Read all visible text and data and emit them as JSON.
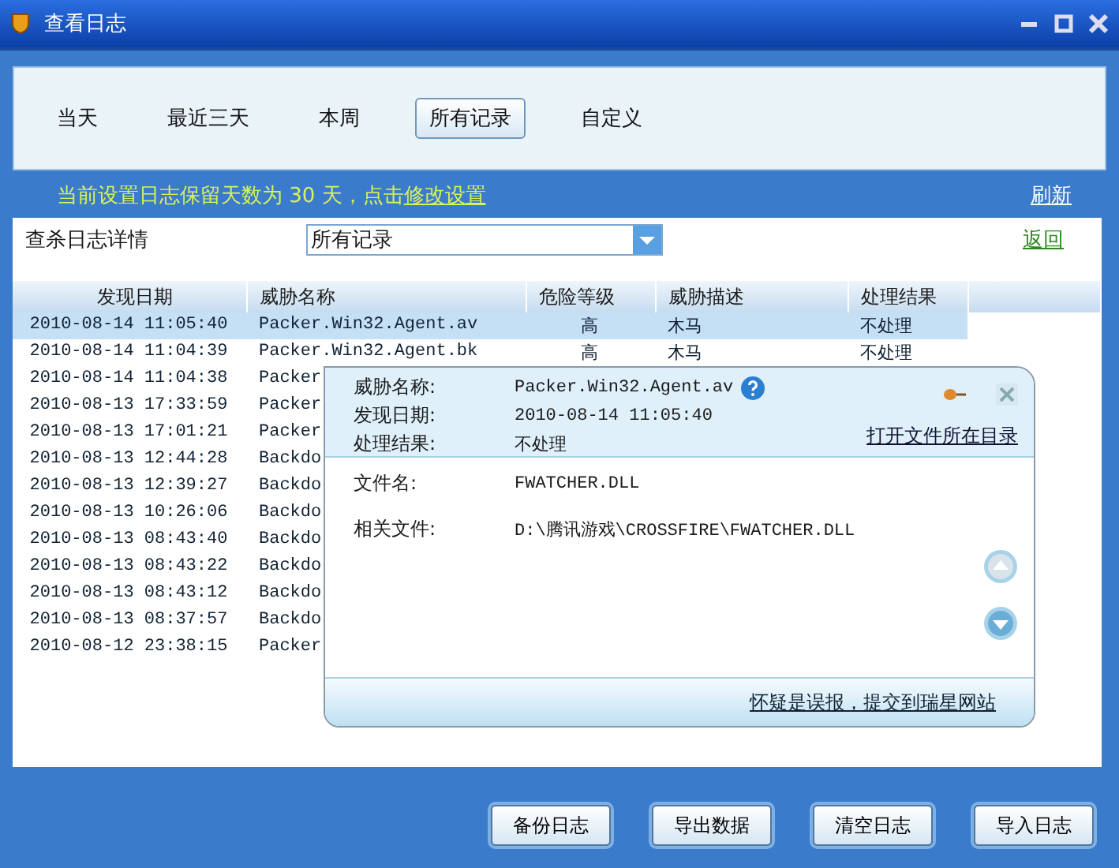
{
  "window": {
    "title": "查看日志"
  },
  "tabs": [
    {
      "label": "当天",
      "selected": false
    },
    {
      "label": "最近三天",
      "selected": false
    },
    {
      "label": "本周",
      "selected": false
    },
    {
      "label": "所有记录",
      "selected": true
    },
    {
      "label": "自定义",
      "selected": false
    }
  ],
  "retention_notice": {
    "text": "当前设置日志保留天数为 30 天，点击",
    "link": "修改设置"
  },
  "refresh_link": "刷新",
  "filter": {
    "label": "查杀日志详情",
    "value": "所有记录"
  },
  "back_link": "返回",
  "table": {
    "columns": [
      "发现日期",
      "威胁名称",
      "危险等级",
      "威胁描述",
      "处理结果"
    ],
    "rows": [
      {
        "cells": [
          "2010-08-14 11:05:40",
          "Packer.Win32.Agent.av",
          "高",
          "木马",
          "不处理"
        ],
        "selected": true
      },
      {
        "cells": [
          "2010-08-14 11:04:39",
          "Packer.Win32.Agent.bk",
          "高",
          "木马",
          "不处理"
        ],
        "selected": false
      },
      {
        "cells": [
          "2010-08-14 11:04:38",
          "Packer"
        ],
        "selected": false
      },
      {
        "cells": [
          "2010-08-13 17:33:59",
          "Packer"
        ],
        "selected": false
      },
      {
        "cells": [
          "2010-08-13 17:01:21",
          "Packer"
        ],
        "selected": false
      },
      {
        "cells": [
          "2010-08-13 12:44:28",
          "Backdo"
        ],
        "selected": false
      },
      {
        "cells": [
          "2010-08-13 12:39:27",
          "Backdo"
        ],
        "selected": false
      },
      {
        "cells": [
          "2010-08-13 10:26:06",
          "Backdo"
        ],
        "selected": false
      },
      {
        "cells": [
          "2010-08-13 08:43:40",
          "Backdo"
        ],
        "selected": false
      },
      {
        "cells": [
          "2010-08-13 08:43:22",
          "Backdo"
        ],
        "selected": false
      },
      {
        "cells": [
          "2010-08-13 08:43:12",
          "Backdo"
        ],
        "selected": false
      },
      {
        "cells": [
          "2010-08-13 08:37:57",
          "Backdo"
        ],
        "selected": false
      },
      {
        "cells": [
          "2010-08-12 23:38:15",
          "Packer"
        ],
        "selected": false
      }
    ]
  },
  "popup": {
    "summary": [
      {
        "label": "威胁名称:",
        "value": "Packer.Win32.Agent.av"
      },
      {
        "label": "发现日期:",
        "value": "2010-08-14 11:05:40"
      },
      {
        "label": "处理结果:",
        "value": "不处理"
      }
    ],
    "open_folder_link": "打开文件所在目录",
    "details": [
      {
        "label": "文件名:",
        "value": "FWATCHER.DLL"
      },
      {
        "label": "相关文件:",
        "value": "D:\\腾讯游戏\\CROSSFIRE\\FWATCHER.DLL"
      }
    ],
    "report_link": "怀疑是误报，提交到瑞星网站"
  },
  "buttons": [
    "备份日志",
    "导出数据",
    "清空日志",
    "导入日志"
  ]
}
